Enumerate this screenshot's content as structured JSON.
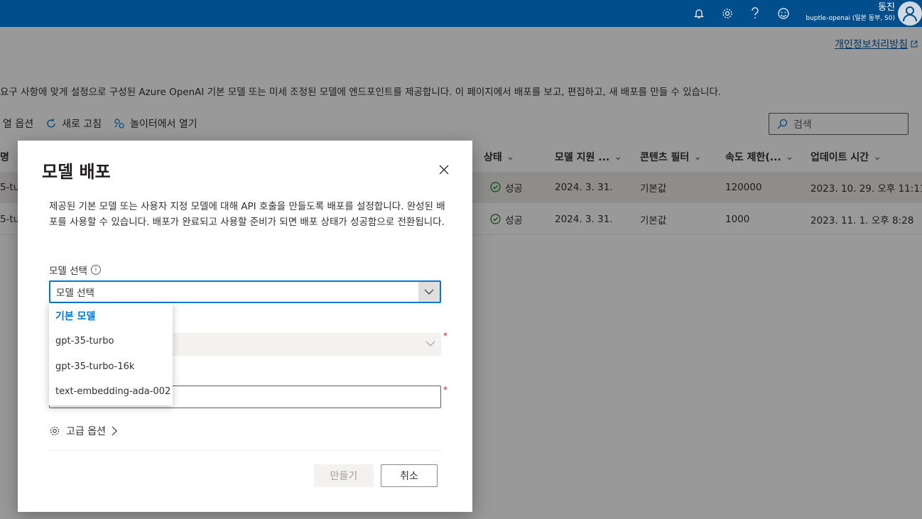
{
  "header": {
    "user_name": "동진",
    "user_sub": "buptle-openai (일본 동부, S0)"
  },
  "page": {
    "privacy_link": "개인정보처리방침",
    "description": "요구 사항에 맞게 설정으로 구성된 Azure OpenAI 기본 모델 또는 미세 조정된 모델에 엔드포인트를 제공합니다. 이 페이지에서 배포를 보고, 편집하고, 새 배포를 만들 수 있습니다.",
    "toolbar": {
      "columns_label": "열 옵션",
      "refresh_label": "새로 고침",
      "playground_label": "놀이터에서 열기"
    },
    "search_placeholder": "검색",
    "table": {
      "headers": [
        "명",
        "상태",
        "모델 지원 ...",
        "콘텐츠 필터",
        "속도 제한(...",
        "업데이트 시간"
      ],
      "rows": [
        {
          "name": "5-tu",
          "status": "성공",
          "model_support": "2024. 3. 31.",
          "content_filter": "기본값",
          "rate_limit": "120000",
          "updated": "2023. 10. 29. 오후 11:11"
        },
        {
          "name": "5-tu",
          "status": "성공",
          "model_support": "2024. 3. 31.",
          "content_filter": "기본값",
          "rate_limit": "1000",
          "updated": "2023. 11. 1. 오후 8:28"
        }
      ]
    }
  },
  "dialog": {
    "title": "모델 배포",
    "description": "제공된 기본 모델 또는 사용자 지정 모델에 대해 API 호출을 만들도록 배포를 설정합니다. 완성된 배포를 사용할 수 있습니다. 배포가 완료되고 사용할 준비가 되면 배포 상태가 성공함으로 전환됩니다.",
    "model_label": "모델 선택",
    "model_value": "모델 선택",
    "dropdown": {
      "group_header": "기본 모델",
      "options": [
        "gpt-35-turbo",
        "gpt-35-turbo-16k",
        "text-embedding-ada-002"
      ]
    },
    "required_mark": "*",
    "advanced_label": "고급 옵션",
    "create_label": "만들기",
    "cancel_label": "취소"
  }
}
